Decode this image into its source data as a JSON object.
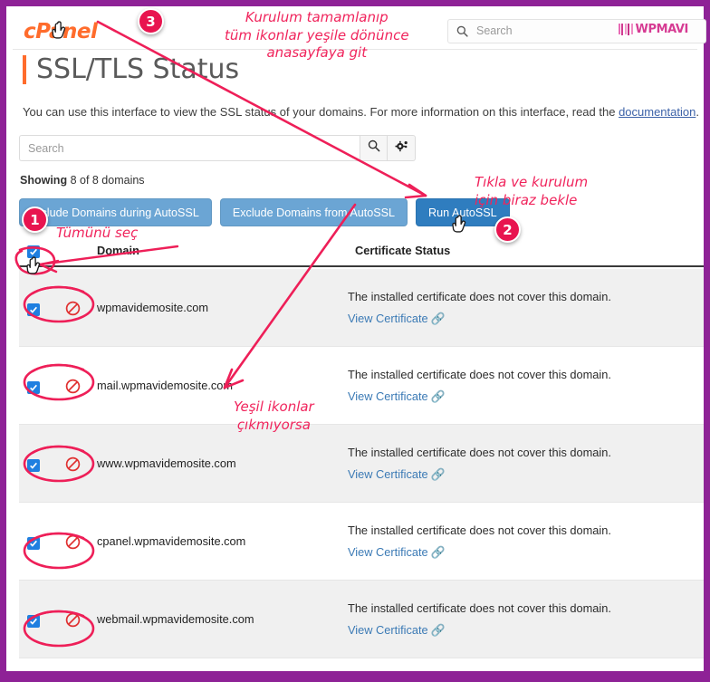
{
  "window": {
    "frame_color": "#8e2296",
    "accent_orange": "#ff6c2c",
    "annotation_color": "#f0245c"
  },
  "topbar": {
    "brand": "cPanel",
    "search_placeholder": "Search",
    "search_value": "",
    "search_icon": "search-icon",
    "watermark": "WPMAVI"
  },
  "page": {
    "title": "SSL/TLS Status",
    "description_before": "You can use this interface to view the SSL status of your domains. For more information on this interface, read the ",
    "description_link": "documentation",
    "description_after": "."
  },
  "filter": {
    "search_placeholder": "Search",
    "search_value": "",
    "search_button_icon": "search-icon",
    "settings_button_icon": "gear-icon"
  },
  "showing": {
    "label": "Showing",
    "count_text": "8 of 8 domains"
  },
  "actions": [
    {
      "label": "Include Domains during AutoSSL",
      "style": "light"
    },
    {
      "label": "Exclude Domains from AutoSSL",
      "style": "light"
    },
    {
      "label": "Run AutoSSL",
      "style": "dark"
    }
  ],
  "table": {
    "select_all_checked": true,
    "columns": [
      "Domain",
      "Certificate Status"
    ],
    "rows": [
      {
        "checked": true,
        "status_icon": "ban-icon",
        "domain": "wpmavidemosite.com",
        "status_message": "The installed certificate does not cover this domain.",
        "link": "View Certificate",
        "link_icon": "external-link-icon"
      },
      {
        "checked": true,
        "status_icon": "ban-icon",
        "domain": "mail.wpmavidemosite.com",
        "status_message": "The installed certificate does not cover this domain.",
        "link": "View Certificate",
        "link_icon": "external-link-icon"
      },
      {
        "checked": true,
        "status_icon": "ban-icon",
        "domain": "www.wpmavidemosite.com",
        "status_message": "The installed certificate does not cover this domain.",
        "link": "View Certificate",
        "link_icon": "external-link-icon"
      },
      {
        "checked": true,
        "status_icon": "ban-icon",
        "domain": "cpanel.wpmavidemosite.com",
        "status_message": "The installed certificate does not cover this domain.",
        "link": "View Certificate",
        "link_icon": "external-link-icon"
      },
      {
        "checked": true,
        "status_icon": "ban-icon",
        "domain": "webmail.wpmavidemosite.com",
        "status_message": "The installed certificate does not cover this domain.",
        "link": "View Certificate",
        "link_icon": "external-link-icon"
      }
    ]
  },
  "annotations": {
    "badge_1": "1",
    "badge_2": "2",
    "badge_3": "3",
    "note_top_line1": "Kurulum tamamlanıp",
    "note_top_line2": "tüm ikonlar yeşile dönünce",
    "note_top_line3": "anasayfaya git",
    "note_run_line1": "Tıkla ve kurulum",
    "note_run_line2": "için biraz bekle",
    "note_select_all": "Tümünü seç",
    "note_green_line1": "Yeşil ikonlar",
    "note_green_line2": "çıkmıyorsa"
  }
}
